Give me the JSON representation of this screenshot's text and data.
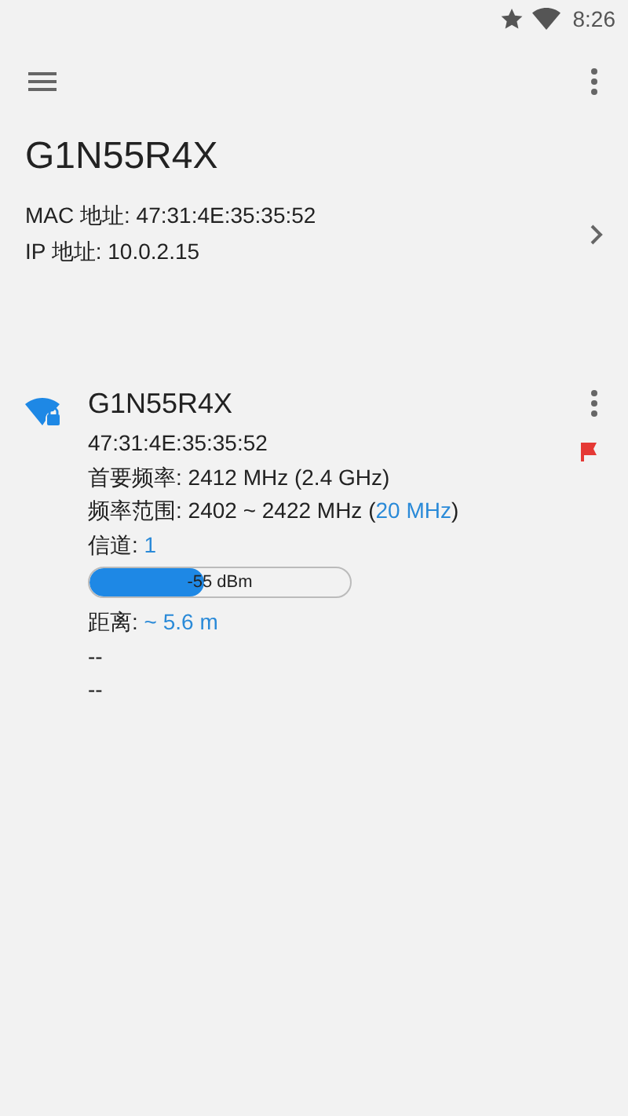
{
  "status_bar": {
    "time": "8:26"
  },
  "header": {
    "ssid": "G1N55R4X",
    "lines": [
      {
        "parts": [
          {
            "text": "MAC 地址: 47:31:4E:35:35:52",
            "accent": false
          }
        ]
      },
      {
        "parts": [
          {
            "text": "IP 地址: 10.0.2.15",
            "accent": false
          }
        ]
      }
    ]
  },
  "network": {
    "ssid": "G1N55R4X",
    "flagged": true,
    "lines": [
      {
        "parts": [
          {
            "text": "47:31:4E:35:35:52",
            "accent": false
          }
        ]
      },
      {
        "parts": [
          {
            "text": "首要频率: 2412 MHz (2.4 GHz)",
            "accent": false
          }
        ]
      },
      {
        "parts": [
          {
            "text": "频率范围: 2402 ~ 2422 MHz (",
            "accent": false
          },
          {
            "text": "20 MHz",
            "accent": true
          },
          {
            "text": ")",
            "accent": false
          }
        ]
      },
      {
        "parts": [
          {
            "text": "信道: ",
            "accent": false
          },
          {
            "text": "1",
            "accent": true
          }
        ]
      }
    ],
    "signal": {
      "level": 0.44,
      "reading": "-55 dBm"
    },
    "lines_after": [
      {
        "parts": [
          {
            "text": "距离: ",
            "accent": false
          },
          {
            "text": "~ 5.6 m",
            "accent": true
          }
        ]
      },
      {
        "parts": [
          {
            "text": "--",
            "accent": false
          }
        ]
      },
      {
        "parts": [
          {
            "text": "--",
            "accent": false
          }
        ]
      }
    ]
  }
}
